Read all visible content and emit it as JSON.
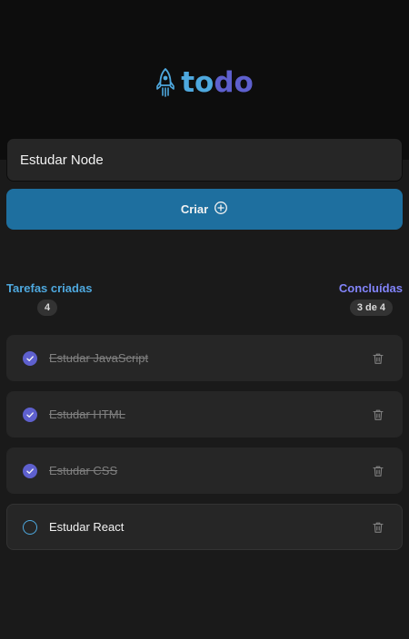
{
  "app": {
    "logo_text_prefix": "to",
    "logo_text_suffix": "do",
    "logo_icon": "rocket-icon",
    "colors": {
      "background": "#1a1a1a",
      "header": "#0d0d0d",
      "blue": "#4ea8de",
      "purple": "#5e60ce",
      "purple_light": "#8284fa",
      "button": "#1e6f9f",
      "card": "#262626"
    }
  },
  "form": {
    "input_value": "Estudar Node",
    "create_label": "Criar",
    "create_icon": "plus-circle-icon"
  },
  "stats": {
    "created_label": "Tarefas criadas",
    "created_count": "4",
    "completed_label": "Concluídas",
    "completed_count": "3 de 4"
  },
  "tasks": [
    {
      "text": "Estudar JavaScript",
      "done": true
    },
    {
      "text": "Estudar HTML",
      "done": true
    },
    {
      "text": "Estudar CSS",
      "done": true
    },
    {
      "text": "Estudar React",
      "done": false
    }
  ]
}
